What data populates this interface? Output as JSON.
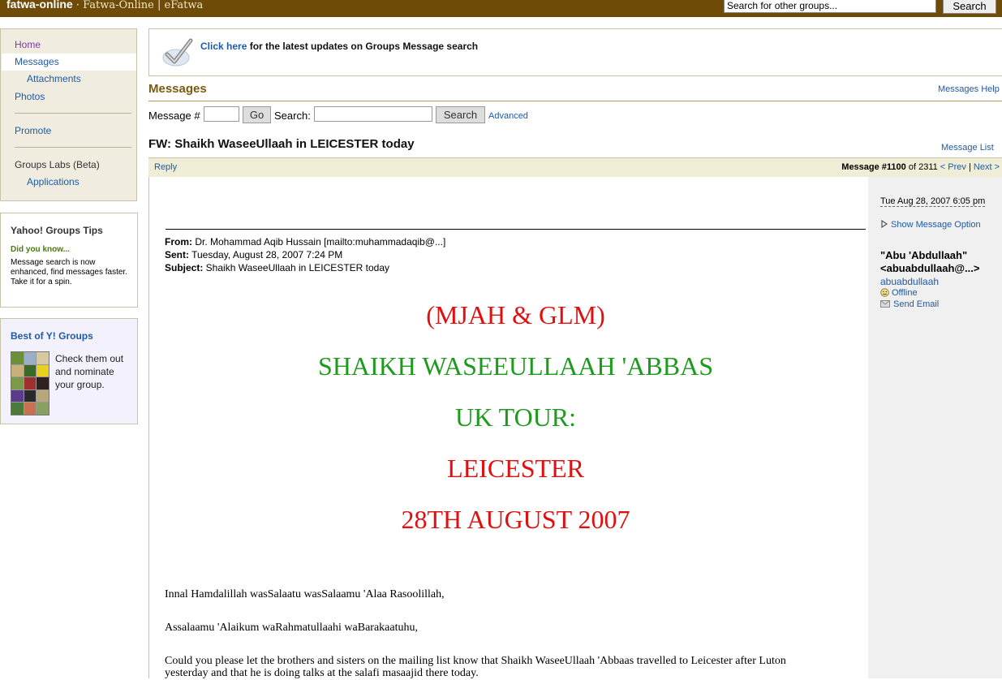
{
  "topbar": {
    "group_id": "fatwa-online",
    "separator": " · ",
    "group_name": "Fatwa-Online | eFatwa",
    "search_placeholder": "Search for other groups...",
    "search_button": "Search"
  },
  "nav": {
    "home": "Home",
    "messages": "Messages",
    "attachments": "Attachments",
    "photos": "Photos",
    "promote": "Promote",
    "labs": "Groups Labs (Beta)",
    "applications": "Applications"
  },
  "tips": {
    "title": "Yahoo! Groups Tips",
    "did_you_know": "Did you know...",
    "text": "Message search is now enhanced, find messages faster. Take it for a spin."
  },
  "best": {
    "title": "Best of Y! Groups",
    "text": "Check them out and nominate your group."
  },
  "banner": {
    "link": "Click here",
    "text": " for the latest updates on Groups Message search"
  },
  "messages": {
    "title": "Messages",
    "help": "Messages Help",
    "msgnum_label": "Message #",
    "go": "Go",
    "search_label": "Search:",
    "search_button": "Search",
    "advanced": "Advanced",
    "subject": "FW: Shaikh WaseeUllaah in LEICESTER today",
    "message_list": "Message List",
    "reply": "Reply",
    "message_label": "Message #1100",
    "of_total": " of 2311 ",
    "prev": "< Prev",
    "pipe": " | ",
    "next": "Next >"
  },
  "email": {
    "from_label": "From:",
    "from": " Dr. Mohammad Aqib Hussain [mailto:muhammadaqib@...]",
    "sent_label": "Sent:",
    "sent": " Tuesday, August 28, 2007 7:24 PM",
    "subject_label": "Subject:",
    "subject": " Shaikh WaseeUllaah in LEICESTER today",
    "line1": "(MJAH & GLM)",
    "line2": "SHAIKH WASEEULLAAH 'ABBAS",
    "line3": "UK TOUR:",
    "line4": "LEICESTER",
    "line5": "28TH AUGUST 2007",
    "para1": "Innal Hamdalillah wasSalaatu wasSalaamu 'Alaa Rasoolillah,",
    "para2": "Assalaamu 'Alaikum waRahmatullaahi waBarakaatuhu,",
    "para3": "Could you please let the brothers and sisters on the mailing list know that Shaikh WaseeUllaah 'Abbaas travelled to Leicester after Luton",
    "para4": "yesterday and that he is doing talks at the salafi masaajid there today."
  },
  "side": {
    "date": "Tue Aug 28, 2007 6:05 pm",
    "show_option": "Show Message Option",
    "author_name": "\"Abu 'Abdullaah\"",
    "author_email": "<abuabdullaah@...>",
    "user_id": "abuabdullaah",
    "status": "Offline",
    "send_email": "Send Email"
  },
  "colors": {
    "topbar": "#6e4b07",
    "link": "#1e5aa8",
    "red_heading": "#e01010",
    "green_heading": "#1e9a1e"
  }
}
